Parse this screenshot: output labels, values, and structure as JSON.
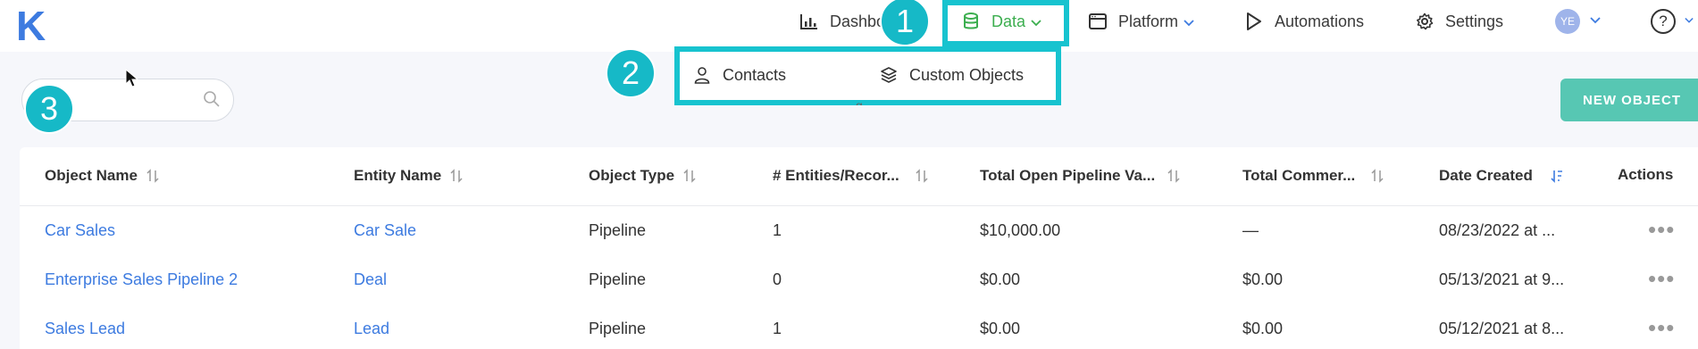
{
  "logo": "K",
  "nav": {
    "dashboard": "Dashbo",
    "data": "Data",
    "platform": "Platform",
    "automations": "Automations",
    "settings": "Settings",
    "avatar_initials": "YE",
    "help": "?"
  },
  "dropdown": {
    "contacts": "Contacts",
    "custom_objects": "Custom Objects"
  },
  "badges": {
    "one": "1",
    "two": "2",
    "three": "3"
  },
  "search": {
    "placeholder": ""
  },
  "new_object_button": "NEW OBJECT",
  "table": {
    "headers": {
      "object_name": "Object Name",
      "entity_name": "Entity Name",
      "object_type": "Object Type",
      "entities": "# Entities/Recor...",
      "pipeline_value": "Total Open Pipeline Va...",
      "commercial": "Total Commer...",
      "date_created": "Date Created",
      "actions": "Actions"
    },
    "rows": [
      {
        "object_name": "Car Sales",
        "entity_name": "Car Sale",
        "object_type": "Pipeline",
        "entities": "1",
        "pipeline_value": "$10,000.00",
        "commercial": "—",
        "date_created": "08/23/2022 at ...",
        "actions": "•••"
      },
      {
        "object_name": "Enterprise Sales Pipeline 2",
        "entity_name": "Deal",
        "object_type": "Pipeline",
        "entities": "0",
        "pipeline_value": "$0.00",
        "commercial": "$0.00",
        "date_created": "05/13/2021 at 9...",
        "actions": "•••"
      },
      {
        "object_name": "Sales Lead",
        "entity_name": "Lead",
        "object_type": "Pipeline",
        "entities": "1",
        "pipeline_value": "$0.00",
        "commercial": "$0.00",
        "date_created": "05/12/2021 at 8...",
        "actions": "•••"
      }
    ]
  },
  "colors": {
    "accent": "#3d7be0",
    "data_active": "#3cae4f",
    "highlight": "#17c3cf",
    "new_button": "#57c7b3"
  }
}
